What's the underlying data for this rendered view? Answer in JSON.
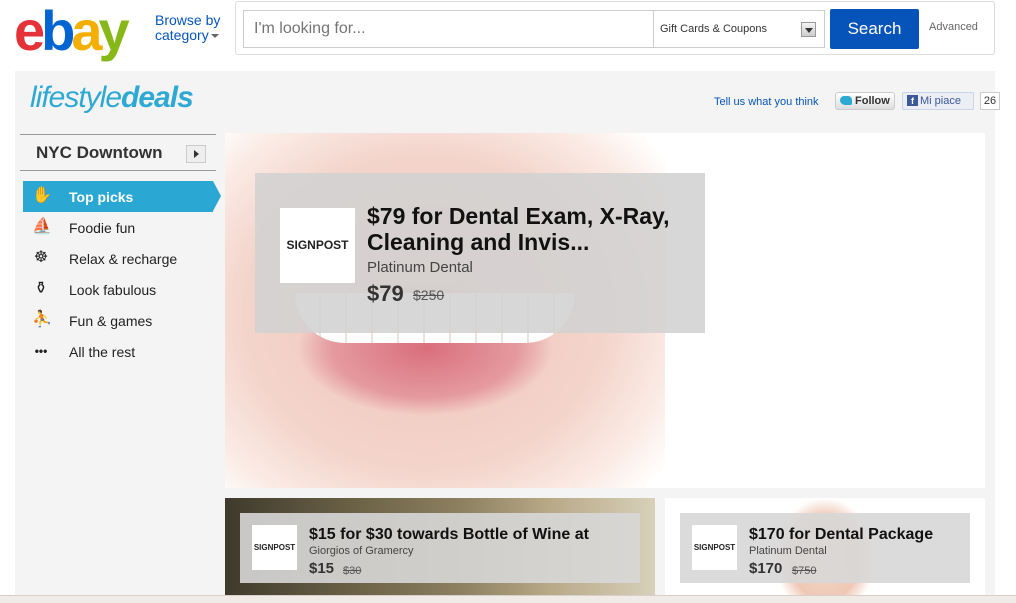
{
  "header": {
    "logo": {
      "e": "e",
      "b": "b",
      "a": "a",
      "y": "y"
    },
    "browse_line1": "Browse by",
    "browse_line2": "category",
    "search_placeholder": "I'm looking for...",
    "category_selected": "Gift Cards & Coupons",
    "search_label": "Search",
    "advanced_label": "Advanced"
  },
  "brand": {
    "lifestyle": "lifestyle",
    "deals": "deals",
    "color": "#2da9d3"
  },
  "social": {
    "tell": "Tell us what you think",
    "follow": "Follow",
    "like": "Mi piace",
    "like_count": "26"
  },
  "sidebar": {
    "city": "NYC Downtown",
    "items": [
      {
        "label": "Top picks",
        "icon": "thumbs-up-icon",
        "glyph": "✋"
      },
      {
        "label": "Foodie fun",
        "icon": "food-dish-icon",
        "glyph": "⛵"
      },
      {
        "label": "Relax & recharge",
        "icon": "meditation-icon",
        "glyph": "☸"
      },
      {
        "label": "Look fabulous",
        "icon": "perfume-icon",
        "glyph": "⚱"
      },
      {
        "label": "Fun & games",
        "icon": "running-person-icon",
        "glyph": "⛹"
      },
      {
        "label": "All the rest",
        "icon": "dots-icon",
        "glyph": "•••"
      }
    ]
  },
  "deals": {
    "main": {
      "logo": "SIGNPOST",
      "title": "$79 for Dental Exam, X-Ray, Cleaning and Invis...",
      "merchant": "Platinum Dental",
      "price": "$79",
      "original": "$250"
    },
    "left": {
      "logo": "SIGNPOST",
      "title": "$15 for $30 towards Bottle of Wine at",
      "merchant": "Giorgios of Gramercy",
      "price": "$15",
      "original": "$30"
    },
    "right": {
      "logo": "SIGNPOST",
      "title": "$170 for Dental Package",
      "merchant": "Platinum Dental",
      "price": "$170",
      "original": "$750"
    }
  }
}
